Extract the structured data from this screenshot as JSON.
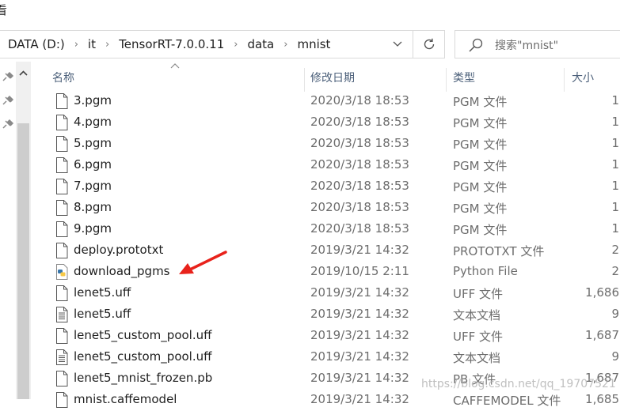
{
  "window": {
    "title_fragment": "看"
  },
  "address": {
    "path": [
      "DATA (D:)",
      "it",
      "TensorRT-7.0.0.11",
      "data",
      "mnist"
    ],
    "search_placeholder": "搜索\"mnist\""
  },
  "columns": {
    "name": "名称",
    "modified": "修改日期",
    "type": "类型",
    "size": "大小"
  },
  "files": [
    {
      "name": "3.pgm",
      "date": "2020/3/18 18:53",
      "type": "PGM 文件",
      "size": "1",
      "icon": "blank-file-icon"
    },
    {
      "name": "4.pgm",
      "date": "2020/3/18 18:53",
      "type": "PGM 文件",
      "size": "1",
      "icon": "blank-file-icon"
    },
    {
      "name": "5.pgm",
      "date": "2020/3/18 18:53",
      "type": "PGM 文件",
      "size": "1",
      "icon": "blank-file-icon"
    },
    {
      "name": "6.pgm",
      "date": "2020/3/18 18:53",
      "type": "PGM 文件",
      "size": "1",
      "icon": "blank-file-icon"
    },
    {
      "name": "7.pgm",
      "date": "2020/3/18 18:53",
      "type": "PGM 文件",
      "size": "1",
      "icon": "blank-file-icon"
    },
    {
      "name": "8.pgm",
      "date": "2020/3/18 18:53",
      "type": "PGM 文件",
      "size": "1",
      "icon": "blank-file-icon"
    },
    {
      "name": "9.pgm",
      "date": "2020/3/18 18:53",
      "type": "PGM 文件",
      "size": "1",
      "icon": "blank-file-icon"
    },
    {
      "name": "deploy.prototxt",
      "date": "2019/3/21 14:32",
      "type": "PROTOTXT 文件",
      "size": "2",
      "icon": "blank-file-icon"
    },
    {
      "name": "download_pgms",
      "date": "2019/10/15 2:11",
      "type": "Python File",
      "size": "2",
      "icon": "python-file-icon"
    },
    {
      "name": "lenet5.uff",
      "date": "2019/3/21 14:32",
      "type": "UFF 文件",
      "size": "1,686",
      "icon": "blank-file-icon"
    },
    {
      "name": "lenet5.uff",
      "date": "2019/3/21 14:32",
      "type": "文本文档",
      "size": "9",
      "icon": "text-file-icon"
    },
    {
      "name": "lenet5_custom_pool.uff",
      "date": "2019/3/21 14:32",
      "type": "UFF 文件",
      "size": "1,687",
      "icon": "blank-file-icon"
    },
    {
      "name": "lenet5_custom_pool.uff",
      "date": "2019/3/21 14:32",
      "type": "文本文档",
      "size": "9",
      "icon": "text-file-icon"
    },
    {
      "name": "lenet5_mnist_frozen.pb",
      "date": "2019/3/21 14:32",
      "type": "PB 文件",
      "size": "1,687",
      "icon": "blank-file-icon"
    },
    {
      "name": "mnist.caffemodel",
      "date": "2019/3/21 14:32",
      "type": "CAFFEMODEL 文件",
      "size": "1,685",
      "icon": "blank-file-icon"
    }
  ],
  "watermark": "https://blog.csdn.net/qq_19707521",
  "colors": {
    "annotation_arrow": "#e8221b",
    "header_text": "#4c607a",
    "scroll_thumb": "#cdcdcd"
  }
}
